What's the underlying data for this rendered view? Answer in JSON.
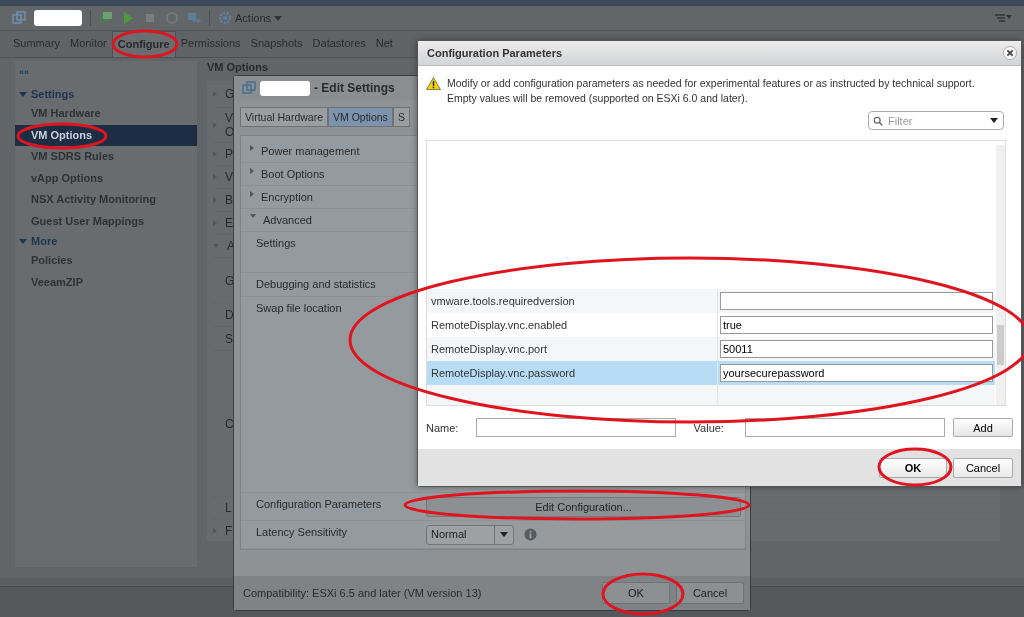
{
  "toolbar": {
    "actions_label": "Actions"
  },
  "tabs": [
    {
      "label": "Summary",
      "selected": false
    },
    {
      "label": "Monitor",
      "selected": false
    },
    {
      "label": "Configure",
      "selected": true
    },
    {
      "label": "Permissions",
      "selected": false
    },
    {
      "label": "Snapshots",
      "selected": false
    },
    {
      "label": "Datastores",
      "selected": false
    },
    {
      "label": "Net",
      "selected": false
    }
  ],
  "sidebar": {
    "collapse_label": "««",
    "groups": [
      {
        "label": "Settings",
        "expanded": true,
        "items": [
          {
            "label": "VM Hardware",
            "selected": false
          },
          {
            "label": "VM Options",
            "selected": true
          },
          {
            "label": "VM SDRS Rules",
            "selected": false
          },
          {
            "label": "vApp Options",
            "selected": false
          },
          {
            "label": "NSX Activity Monitoring",
            "selected": false
          },
          {
            "label": "Guest User Mappings",
            "selected": false
          }
        ]
      },
      {
        "label": "More",
        "expanded": true,
        "items": [
          {
            "label": "Policies",
            "selected": false
          },
          {
            "label": "VeeamZIP",
            "selected": false
          }
        ]
      }
    ]
  },
  "main_panel": {
    "heading": "VM Options",
    "rows": [
      {
        "text": "G",
        "expanded": false
      },
      {
        "text": "V\nO",
        "expanded": false
      },
      {
        "text": "P",
        "expanded": false
      },
      {
        "text": "V",
        "expanded": false
      },
      {
        "text": "B",
        "expanded": false
      },
      {
        "text": "E",
        "expanded": false
      },
      {
        "text": "A",
        "expanded": true
      },
      {
        "text": "G"
      },
      {
        "text": "D"
      },
      {
        "text": "S"
      },
      {
        "text": "C"
      },
      {
        "text": "L"
      },
      {
        "text": "F",
        "expanded": false
      }
    ]
  },
  "edit_settings": {
    "title": "- Edit Settings",
    "tabs": [
      {
        "label": "Virtual Hardware",
        "selected": false
      },
      {
        "label": "VM Options",
        "selected": true
      },
      {
        "label": "S",
        "selected": false
      }
    ],
    "rows": [
      {
        "kind": "group",
        "label": "Power management",
        "expanded": false
      },
      {
        "kind": "group",
        "label": "Boot Options",
        "expanded": false
      },
      {
        "kind": "group",
        "label": "Encryption",
        "expanded": false
      },
      {
        "kind": "group",
        "label": "Advanced",
        "expanded": true
      },
      {
        "kind": "item",
        "label": "Settings"
      },
      {
        "kind": "item",
        "label": "Debugging and statistics"
      },
      {
        "kind": "item",
        "label": "Swap file location"
      },
      {
        "kind": "button",
        "label": "Configuration Parameters",
        "button": "Edit Configuration..."
      },
      {
        "kind": "select",
        "label": "Latency Sensitivity",
        "value": "Normal"
      }
    ],
    "compatibility": "Compatibility: ESXi 6.5 and later (VM version 13)",
    "buttons": [
      "OK",
      "Cancel"
    ]
  },
  "config_dialog": {
    "title": "Configuration Parameters",
    "message": "Modify or add configuration parameters as needed for experimental features or as instructed by technical support. Empty values will be removed (supported on ESXi 6.0 and later).",
    "filter": {
      "placeholder": "Filter"
    },
    "rows": [
      {
        "name": "vmware.tools.requiredversion",
        "value": "",
        "selected": false
      },
      {
        "name": "RemoteDisplay.vnc.enabled",
        "value": "true",
        "selected": false
      },
      {
        "name": "RemoteDisplay.vnc.port",
        "value": "50011",
        "selected": false
      },
      {
        "name": "RemoteDisplay.vnc.password",
        "value": "yoursecurepassword",
        "selected": true
      }
    ],
    "name_label": "Name:",
    "value_label": "Value:",
    "add_button": "Add",
    "buttons": [
      "OK",
      "Cancel"
    ]
  }
}
